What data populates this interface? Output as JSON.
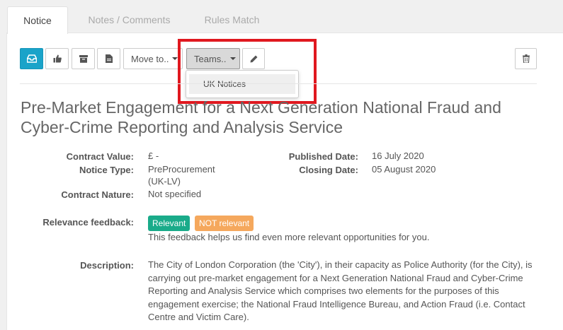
{
  "tabs": [
    {
      "label": "Notice",
      "active": true
    },
    {
      "label": "Notes / Comments",
      "active": false
    },
    {
      "label": "Rules Match",
      "active": false
    }
  ],
  "toolbar": {
    "move_to_label": "Move to..",
    "teams_label": "Teams..",
    "teams_dropdown": {
      "items": [
        "UK Notices"
      ]
    }
  },
  "colors": {
    "primary": "#1aa3c9",
    "relevant": "#1aab8a",
    "not_relevant": "#f5a85d",
    "highlight": "#e0181f"
  },
  "notice": {
    "title": "Pre-Market Engagement for a Next Generation National Fraud and Cyber-Crime Reporting and Analysis Service",
    "contract_value_label": "Contract Value:",
    "contract_value": "£ -",
    "notice_type_label": "Notice Type:",
    "notice_type": "PreProcurement",
    "notice_type_sub": "(UK-LV)",
    "contract_nature_label": "Contract Nature:",
    "contract_nature": "Not specified",
    "published_date_label": "Published Date:",
    "published_date": "16 July 2020",
    "closing_date_label": "Closing Date:",
    "closing_date": "05 August 2020",
    "relevance_label": "Relevance feedback:",
    "relevant_label": "Relevant",
    "not_relevant_label": "NOT relevant",
    "feedback_help": "This feedback helps us find even more relevant opportunities for you.",
    "description_label": "Description:",
    "description": "The City of London Corporation (the 'City'), in their capacity as Police Authority (for the City), is carrying out pre-market engagement for a Next Generation National Fraud and Cyber-Crime Reporting and Analysis Service which comprises two elements for the purposes of this engagement exercise; the National Fraud Intelligence Bureau, and Action Fraud (i.e. Contact Centre and Victim Care)."
  }
}
